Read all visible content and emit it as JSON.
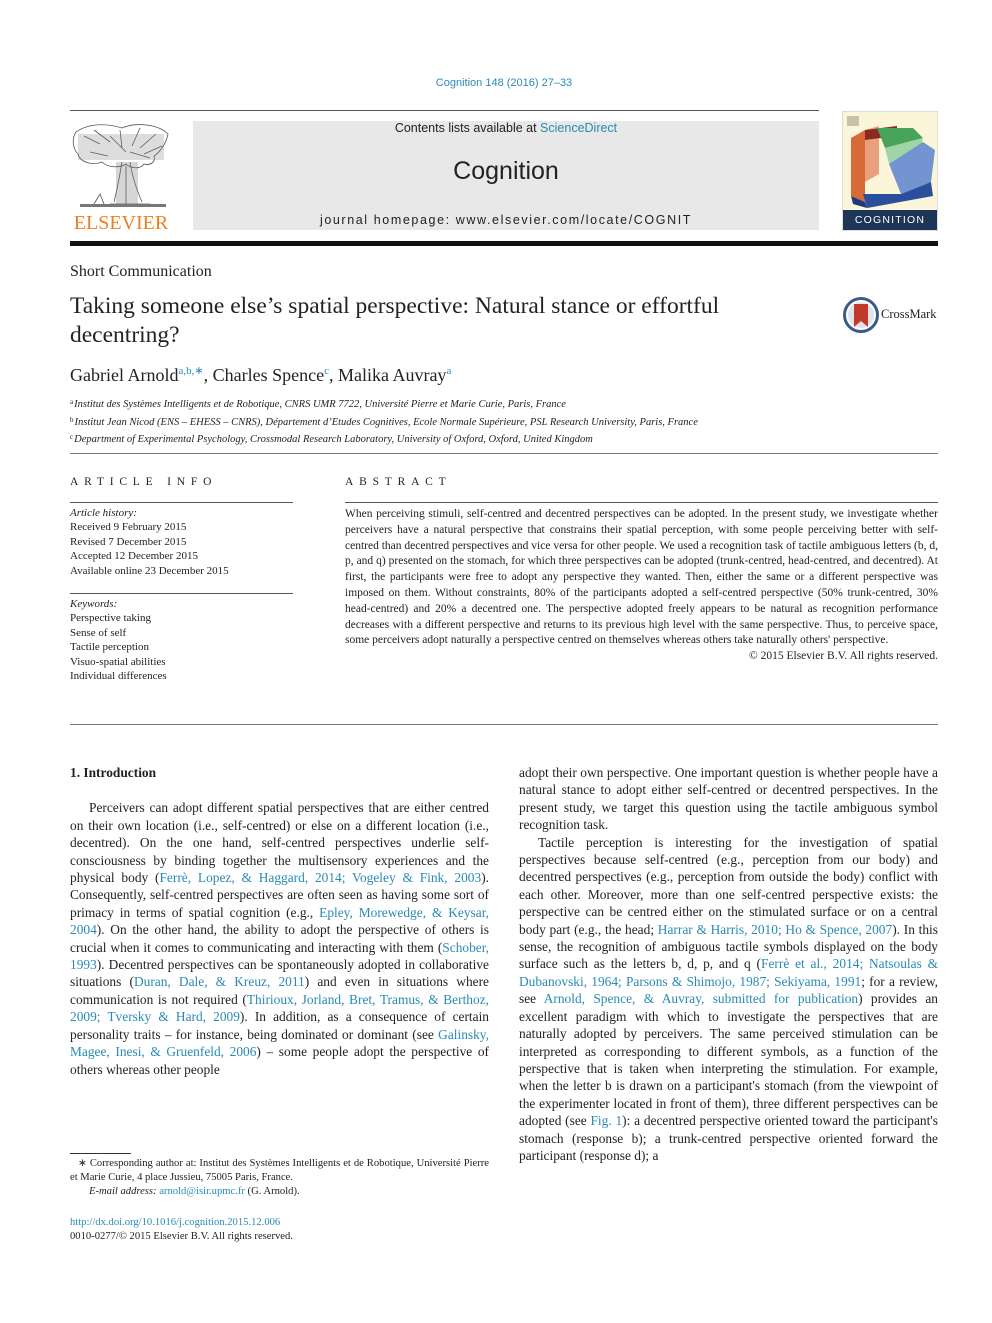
{
  "header": {
    "journal_ref": "Cognition 148 (2016) 27–33",
    "contents_prefix": "Contents lists available at ",
    "contents_link": "ScienceDirect",
    "journal_title": "Cognition",
    "homepage": "journal homepage: www.elsevier.com/locate/COGNIT",
    "publisher_logo_text": "ELSEVIER",
    "cover_label": "COGNITION",
    "brand_colors": {
      "elsevier_orange": "#f07e1e",
      "link_blue": "#2a8ab5",
      "cover_navy": "#1d3557"
    }
  },
  "article": {
    "type": "Short Communication",
    "title": "Taking someone else’s spatial perspective: Natural stance or effortful decentring?",
    "crossmark_label": "CrossMark",
    "authors": [
      {
        "name": "Gabriel Arnold",
        "sup": "a,b,∗"
      },
      {
        "name": "Charles Spence",
        "sup": "c"
      },
      {
        "name": "Malika Auvray",
        "sup": "a"
      }
    ],
    "affiliations": [
      {
        "mark": "a",
        "text": "Institut des Systèmes Intelligents et de Robotique, CNRS UMR 7722, Université Pierre et Marie Curie, Paris, France"
      },
      {
        "mark": "b",
        "text": "Institut Jean Nicod (ENS – EHESS – CNRS), Département d’Etudes Cognitives, Ecole Normale Supérieure, PSL Research University, Paris, France"
      },
      {
        "mark": "c",
        "text": "Department of Experimental Psychology, Crossmodal Research Laboratory, University of Oxford, Oxford, United Kingdom"
      }
    ]
  },
  "article_info": {
    "heading": "ARTICLE INFO",
    "history_label": "Article history:",
    "history": [
      "Received 9 February 2015",
      "Revised 7 December 2015",
      "Accepted 12 December 2015",
      "Available online 23 December 2015"
    ],
    "keywords_label": "Keywords:",
    "keywords": [
      "Perspective taking",
      "Sense of self",
      "Tactile perception",
      "Visuo-spatial abilities",
      "Individual differences"
    ]
  },
  "abstract": {
    "heading": "ABSTRACT",
    "text": "When perceiving stimuli, self-centred and decentred perspectives can be adopted. In the present study, we investigate whether perceivers have a natural perspective that constrains their spatial perception, with some people perceiving better with self-centred than decentred perspectives and vice versa for other people. We used a recognition task of tactile ambiguous letters (b, d, p, and q) presented on the stomach, for which three perspectives can be adopted (trunk-centred, head-centred, and decentred). At first, the participants were free to adopt any perspective they wanted. Then, either the same or a different perspective was imposed on them. Without constraints, 80% of the participants adopted a self-centred perspective (50% trunk-centred, 30% head-centred) and 20% a decentred one. The perspective adopted freely appears to be natural as recognition performance decreases with a different perspective and returns to its previous high level with the same perspective. Thus, to perceive space, some perceivers adopt naturally a perspective centred on themselves whereas others take naturally others' perspective.",
    "copyright": "© 2015 Elsevier B.V. All rights reserved."
  },
  "body": {
    "section_heading": "1. Introduction",
    "left_para": [
      {
        "t": "Perceivers can adopt different spatial perspectives that are either centred on their own location (i.e., self-centred) or else on a different location (i.e., decentred). On the one hand, self-centred perspectives underlie self-consciousness by binding together the multisensory experiences and the physical body ("
      },
      {
        "l": "Ferrè, Lopez, & Haggard, 2014; Vogeley & Fink, 2003"
      },
      {
        "t": "). Consequently, self-centred perspectives are often seen as having some sort of primacy in terms of spatial cognition (e.g., "
      },
      {
        "l": "Epley, Morewedge, & Keysar, 2004"
      },
      {
        "t": "). On the other hand, the ability to adopt the perspective of others is crucial when it comes to communicating and interacting with them ("
      },
      {
        "l": "Schober, 1993"
      },
      {
        "t": "). Decentred perspectives can be spontaneously adopted in collaborative situations ("
      },
      {
        "l": "Duran, Dale, & Kreuz, 2011"
      },
      {
        "t": ") and even in situations where communication is not required ("
      },
      {
        "l": "Thirioux, Jorland, Bret, Tramus, & Berthoz, 2009; Tversky & Hard, 2009"
      },
      {
        "t": "). In addition, as a consequence of certain personality traits – for instance, being dominated or dominant (see "
      },
      {
        "l": "Galinsky, Magee, Inesi, & Gruenfeld, 2006"
      },
      {
        "t": ") – some people adopt the perspective of others whereas other people"
      }
    ],
    "right_para1": [
      {
        "t": "adopt their own perspective. One important question is whether people have a natural stance to adopt either self-centred or decentred perspectives. In the present study, we target this question using the tactile ambiguous symbol recognition task."
      }
    ],
    "right_para2": [
      {
        "t": "Tactile perception is interesting for the investigation of spatial perspectives because self-centred (e.g., perception from our body) and decentred perspectives (e.g., perception from outside the body) conflict with each other. Moreover, more than one self-centred perspective exists: the perspective can be centred either on the stimulated surface or on a central body part (e.g., the head; "
      },
      {
        "l": "Harrar & Harris, 2010; Ho & Spence, 2007"
      },
      {
        "t": "). In this sense, the recognition of ambiguous tactile symbols displayed on the body surface such as the letters b, d, p, and q ("
      },
      {
        "l": "Ferrè et al., 2014; Natsoulas & Dubanovski, 1964; Parsons & Shimojo, 1987; Sekiyama, 1991"
      },
      {
        "t": "; for a review, see "
      },
      {
        "l": "Arnold, Spence, & Auvray, submitted for publication"
      },
      {
        "t": ") provides an excellent paradigm with which to investigate the perspectives that are naturally adopted by perceivers. The same perceived stimulation can be interpreted as corresponding to different symbols, as a function of the perspective that is taken when interpreting the stimulation. For example, when the letter b is drawn on a participant's stomach (from the viewpoint of the experimenter located in front of them), three different perspectives can be adopted (see "
      },
      {
        "l": "Fig. 1"
      },
      {
        "t": "): a decentred perspective oriented toward the participant's stomach (response b); a trunk-centred perspective oriented forward the participant (response d); a"
      }
    ]
  },
  "footnotes": {
    "corresponding": "∗ Corresponding author at: Institut des Systèmes Intelligents et de Robotique, Université Pierre et Marie Curie, 4 place Jussieu, 75005 Paris, France.",
    "email_label": "E-mail address: ",
    "email": "arnold@isir.upmc.fr",
    "email_suffix": " (G. Arnold).",
    "doi": "http://dx.doi.org/10.1016/j.cognition.2015.12.006",
    "issn": "0010-0277/© 2015 Elsevier B.V. All rights reserved."
  }
}
